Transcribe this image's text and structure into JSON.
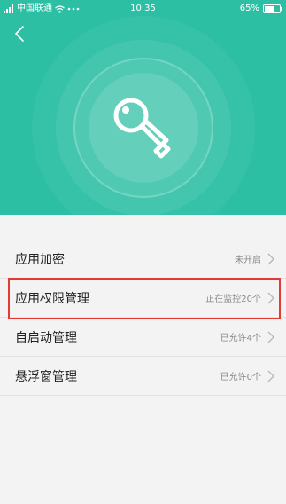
{
  "status_bar": {
    "carrier": "中国联通",
    "time": "10:35",
    "battery": "65%",
    "battery_level": 0.65
  },
  "header": {
    "back_icon": "chevron-left-icon",
    "hero_icon": "key-icon",
    "accent_color": "#2cbfa4"
  },
  "settings": [
    {
      "label": "应用加密",
      "status": "未开启"
    },
    {
      "label": "应用权限管理",
      "status": "正在监控20个"
    },
    {
      "label": "自启动管理",
      "status": "已允许4个"
    },
    {
      "label": "悬浮窗管理",
      "status": "已允许0个"
    }
  ],
  "highlight_color": "#e53935"
}
